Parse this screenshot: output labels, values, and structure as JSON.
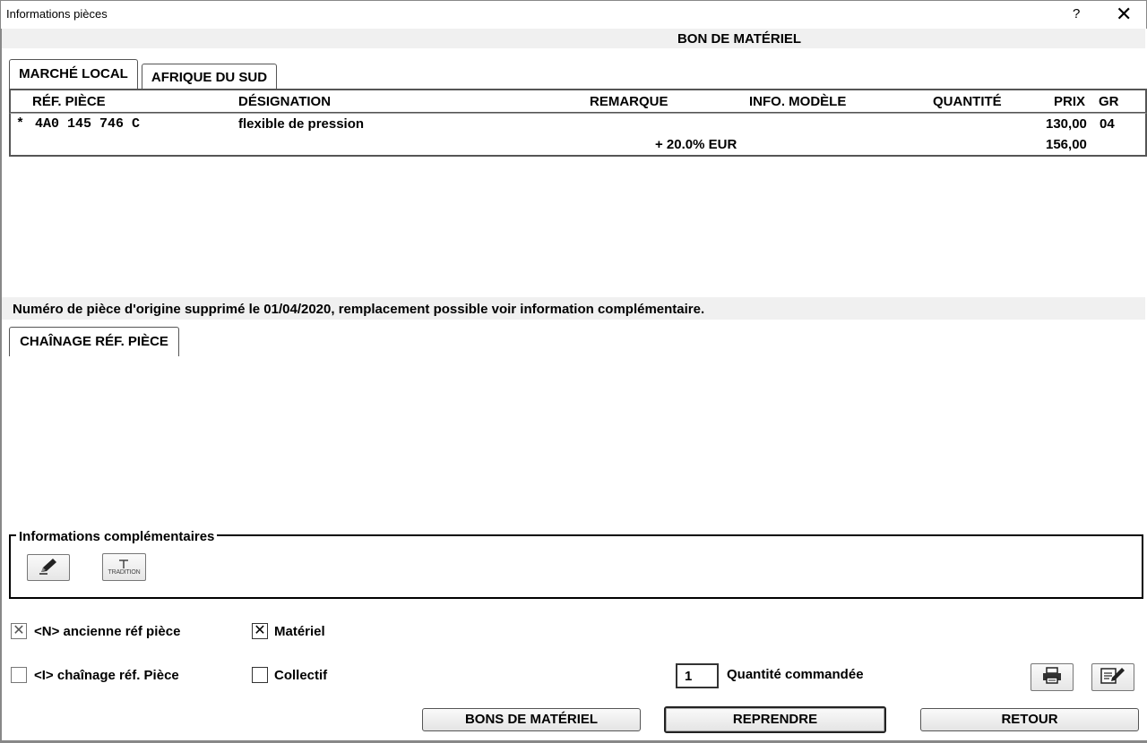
{
  "window": {
    "title": "Informations pièces",
    "help_label": "?",
    "close_label": "✕"
  },
  "header": {
    "title": "BON DE MATÉRIEL"
  },
  "market_tabs": [
    {
      "label": "MARCHÉ LOCAL",
      "active": true
    },
    {
      "label": "AFRIQUE DU SUD",
      "active": false
    }
  ],
  "grid": {
    "columns": [
      "RÉF. PIÈCE",
      "DÉSIGNATION",
      "REMARQUE",
      "INFO. MODÈLE",
      "QUANTITÉ",
      "PRIX",
      "GR"
    ],
    "row": {
      "marker": "*",
      "ref": "4A0 145 746 C",
      "designation": "flexible de pression",
      "price": "130,00",
      "gr": "04",
      "tax_note": "+ 20.0% EUR",
      "price_with_tax": "156,00"
    }
  },
  "message": "Numéro de pièce d'origine supprimé le 01/04/2020, remplacement possible voir information complémentaire.",
  "chain_tab": {
    "label": "CHAÎNAGE RÉF. PIÈCE"
  },
  "info_group": {
    "label": "Informations complémentaires",
    "icons": [
      "pencil-icon",
      "tradition-icon"
    ],
    "tradition_caption": "TRADITION"
  },
  "options": {
    "old_ref": {
      "label": "<N> ancienne réf pièce",
      "checked": true
    },
    "material": {
      "label": "Matériel",
      "checked": true
    },
    "chain_ref": {
      "label": "<I> chaînage réf. Pièce",
      "checked": false
    },
    "collective": {
      "label": "Collectif",
      "checked": false
    }
  },
  "quantity": {
    "value": "1",
    "label": "Quantité commandée"
  },
  "buttons": {
    "bons": "BONS DE MATÉRIEL",
    "reprendre": "REPRENDRE",
    "retour": "RETOUR"
  },
  "action_icons": [
    "printer-icon",
    "edit-note-icon"
  ]
}
